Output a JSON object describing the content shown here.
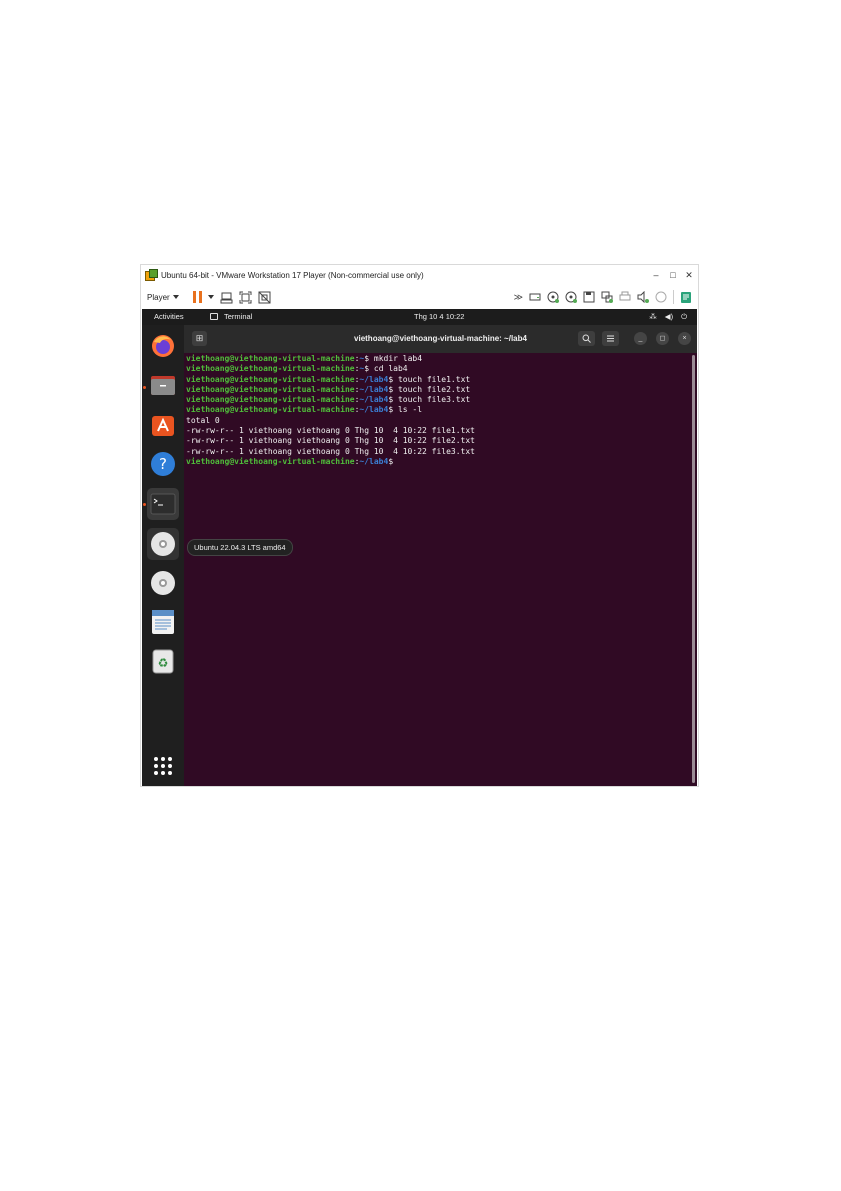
{
  "window": {
    "title": "Ubuntu 64-bit - VMware Workstation 17 Player (Non-commercial use only)",
    "controls": {
      "minimize": "–",
      "maximize": "□",
      "close": "✕"
    }
  },
  "toolbar": {
    "player_label": "Player",
    "icons": [
      "pause-icon",
      "send-ctrl-alt-del-icon",
      "fullscreen-icon",
      "unity-icon"
    ],
    "right_icons": [
      "forward-icon",
      "hard-disk-icon",
      "cd-dvd-icon",
      "cd-dvd-icon",
      "floppy-icon",
      "network-adapter-icon",
      "printer-icon",
      "sound-card-icon",
      "usb-icon",
      "message-log-icon"
    ]
  },
  "ubuntu": {
    "activities": "Activities",
    "app_label": "Terminal",
    "clock": "Thg 10 4  10:22",
    "tray": {
      "network": "network-icon",
      "volume": "volume-icon",
      "power": "power-icon"
    }
  },
  "dock": {
    "items": [
      "firefox-icon",
      "files-icon",
      "app-center-icon",
      "help-icon",
      "terminal-icon",
      "dvd-icon",
      "dvd-icon",
      "text-editor-icon",
      "trash-icon"
    ],
    "tooltip": "Ubuntu 22.04.3 LTS amd64",
    "show_apps": "show-apps-icon"
  },
  "terminal": {
    "title": "viethoang@viethoang-virtual-machine: ~/lab4",
    "prompt_user": "viethoang@viethoang-virtual-machine",
    "lines": [
      {
        "path": "~",
        "cmd": "mkdir lab4"
      },
      {
        "path": "~",
        "cmd": "cd lab4"
      },
      {
        "path": "~/lab4",
        "cmd": "touch file1.txt"
      },
      {
        "path": "~/lab4",
        "cmd": "touch file2.txt"
      },
      {
        "path": "~/lab4",
        "cmd": "touch file3.txt"
      },
      {
        "path": "~/lab4",
        "cmd": "ls -l"
      }
    ],
    "output": [
      "total 0",
      "-rw-rw-r-- 1 viethoang viethoang 0 Thg 10  4 10:22 file1.txt",
      "-rw-rw-r-- 1 viethoang viethoang 0 Thg 10  4 10:22 file2.txt",
      "-rw-rw-r-- 1 viethoang viethoang 0 Thg 10  4 10:22 file3.txt"
    ],
    "final_path": "~/lab4"
  },
  "colors": {
    "terminal_bg": "#300a24",
    "prompt_user": "#4fbd3a",
    "prompt_path": "#3b7fd4",
    "accent": "#e95420"
  }
}
